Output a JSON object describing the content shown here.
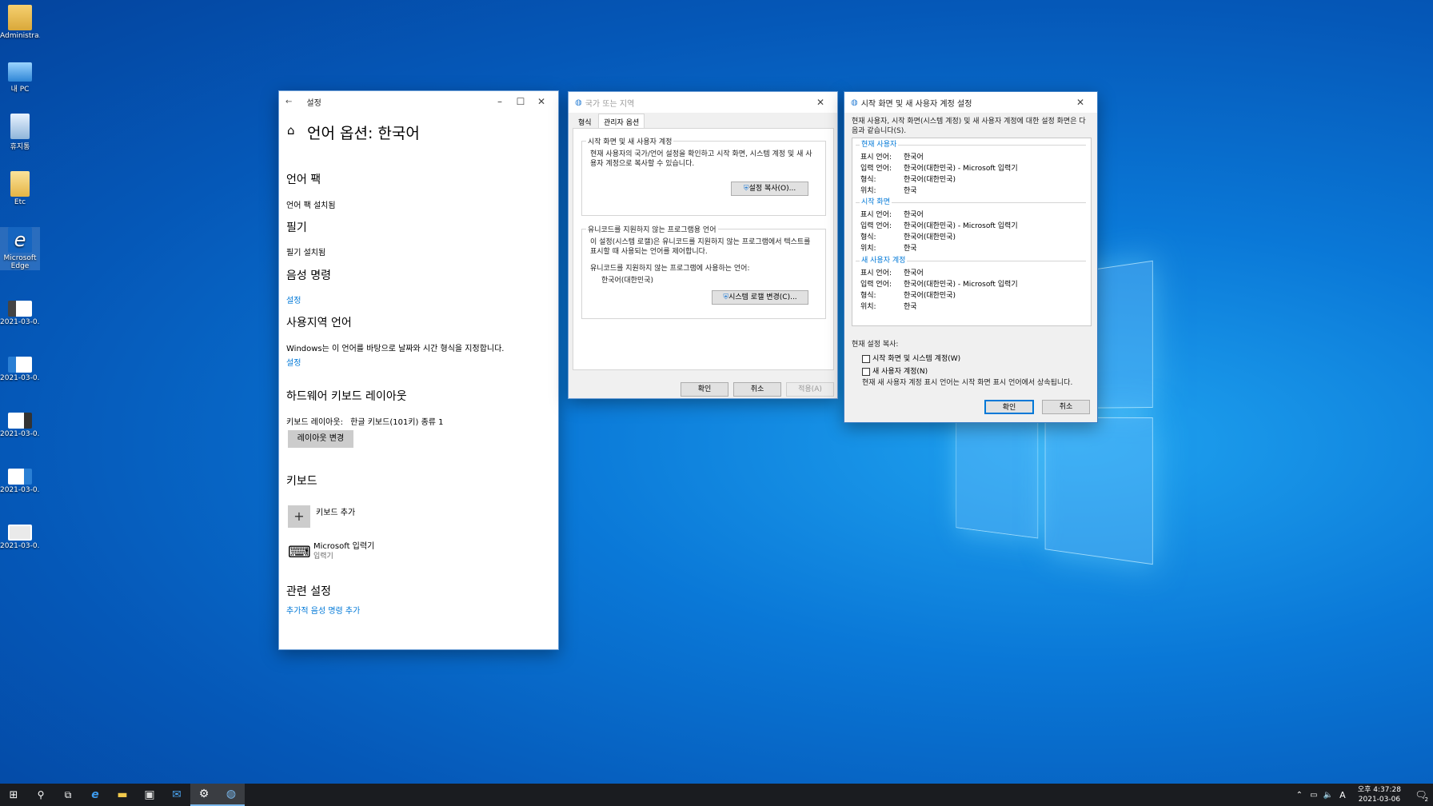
{
  "desktop": {
    "icons": [
      {
        "label": "Administra..."
      },
      {
        "label": "내 PC"
      },
      {
        "label": "휴지통"
      },
      {
        "label": "Etc"
      },
      {
        "label": "Microsoft Edge"
      },
      {
        "label": "2021-03-0..."
      },
      {
        "label": "2021-03-0..."
      },
      {
        "label": "2021-03-0..."
      },
      {
        "label": "2021-03-0..."
      },
      {
        "label": "2021-03-0..."
      }
    ]
  },
  "settings": {
    "window_title": "설정",
    "page_title": "언어 옵션: 한국어",
    "language_pack_heading": "언어 팩",
    "language_pack_status": "언어 팩 설치됨",
    "handwriting_heading": "필기",
    "handwriting_status": "필기 설치됨",
    "speech_heading": "음성 명령",
    "speech_link": "설정",
    "regional_heading": "사용지역 언어",
    "regional_desc": "Windows는 이 언어를 바탕으로 날짜와 시간 형식을 지정합니다.",
    "regional_link": "설정",
    "hw_keyboard_heading": "하드웨어 키보드 레이아웃",
    "keyboard_layout_label": "키보드 레이아웃:",
    "keyboard_layout_value": "한글 키보드(101키) 종류 1",
    "change_layout_button": "레이아웃 변경",
    "keyboards_heading": "키보드",
    "add_keyboard": "키보드 추가",
    "ime_name": "Microsoft 입력기",
    "ime_type": "입력기",
    "related_heading": "관련 설정",
    "related_link": "추가적 음성 명령 추가"
  },
  "region": {
    "window_title": "국가 또는 지역",
    "tabs": [
      "형식",
      "관리자 옵션"
    ],
    "welcome_group": "시작 화면 및 새 사용자 계정",
    "welcome_desc": "현재 사용자의 국가/언어 설정을 확인하고 시작 화면, 시스템 계정 및 새 사용자 계정으로 복사할 수 있습니다.",
    "copy_settings_button": "설정 복사(O)...",
    "unicode_group": "유니코드를 지원하지 않는 프로그램용 언어",
    "unicode_desc": "이 설정(시스템 로캘)은 유니코드를 지원하지 않는 프로그램에서 텍스트를 표시할 때 사용되는 언어를 제어합니다.",
    "current_lang_label": "유니코드를 지원하지 않는 프로그램에 사용하는 언어:",
    "current_lang_value": "한국어(대한민국)",
    "change_locale_button": "시스템 로캘 변경(C)...",
    "ok": "확인",
    "cancel": "취소",
    "apply": "적용(A)"
  },
  "welcome": {
    "window_title": "시작 화면 및 새 사용자 계정 설정",
    "intro": "현재 사용자, 시작 화면(시스템 계정) 및 새 사용자 계정에 대한 설정 화면은 다음과 같습니다(S).",
    "sections": [
      {
        "title": "현재 사용자",
        "rows": [
          [
            "표시 언어:",
            "한국어"
          ],
          [
            "입력 언어:",
            "한국어(대한민국) - Microsoft 입력기"
          ],
          [
            "형식:",
            "한국어(대한민국)"
          ],
          [
            "위치:",
            "한국"
          ]
        ]
      },
      {
        "title": "시작 화면",
        "rows": [
          [
            "표시 언어:",
            "한국어"
          ],
          [
            "입력 언어:",
            "한국어(대한민국) - Microsoft 입력기"
          ],
          [
            "형식:",
            "한국어(대한민국)"
          ],
          [
            "위치:",
            "한국"
          ]
        ]
      },
      {
        "title": "새 사용자 계정",
        "rows": [
          [
            "표시 언어:",
            "한국어"
          ],
          [
            "입력 언어:",
            "한국어(대한민국) - Microsoft 입력기"
          ],
          [
            "형식:",
            "한국어(대한민국)"
          ],
          [
            "위치:",
            "한국"
          ]
        ]
      }
    ],
    "copy_label": "현재 설정 복사:",
    "check_welcome": "시작 화면 및 시스템 계정(W)",
    "check_new_user": "새 사용자 계정(N)",
    "note": "현재 새 사용자 계정 표시 언어는 시작 화면 표시 언어에서 상속됩니다.",
    "ok": "확인",
    "cancel": "취소"
  },
  "taskbar": {
    "time": "오후 4:37:28",
    "date": "2021-03-06",
    "ime_indicator": "A",
    "notification_count": "2"
  }
}
